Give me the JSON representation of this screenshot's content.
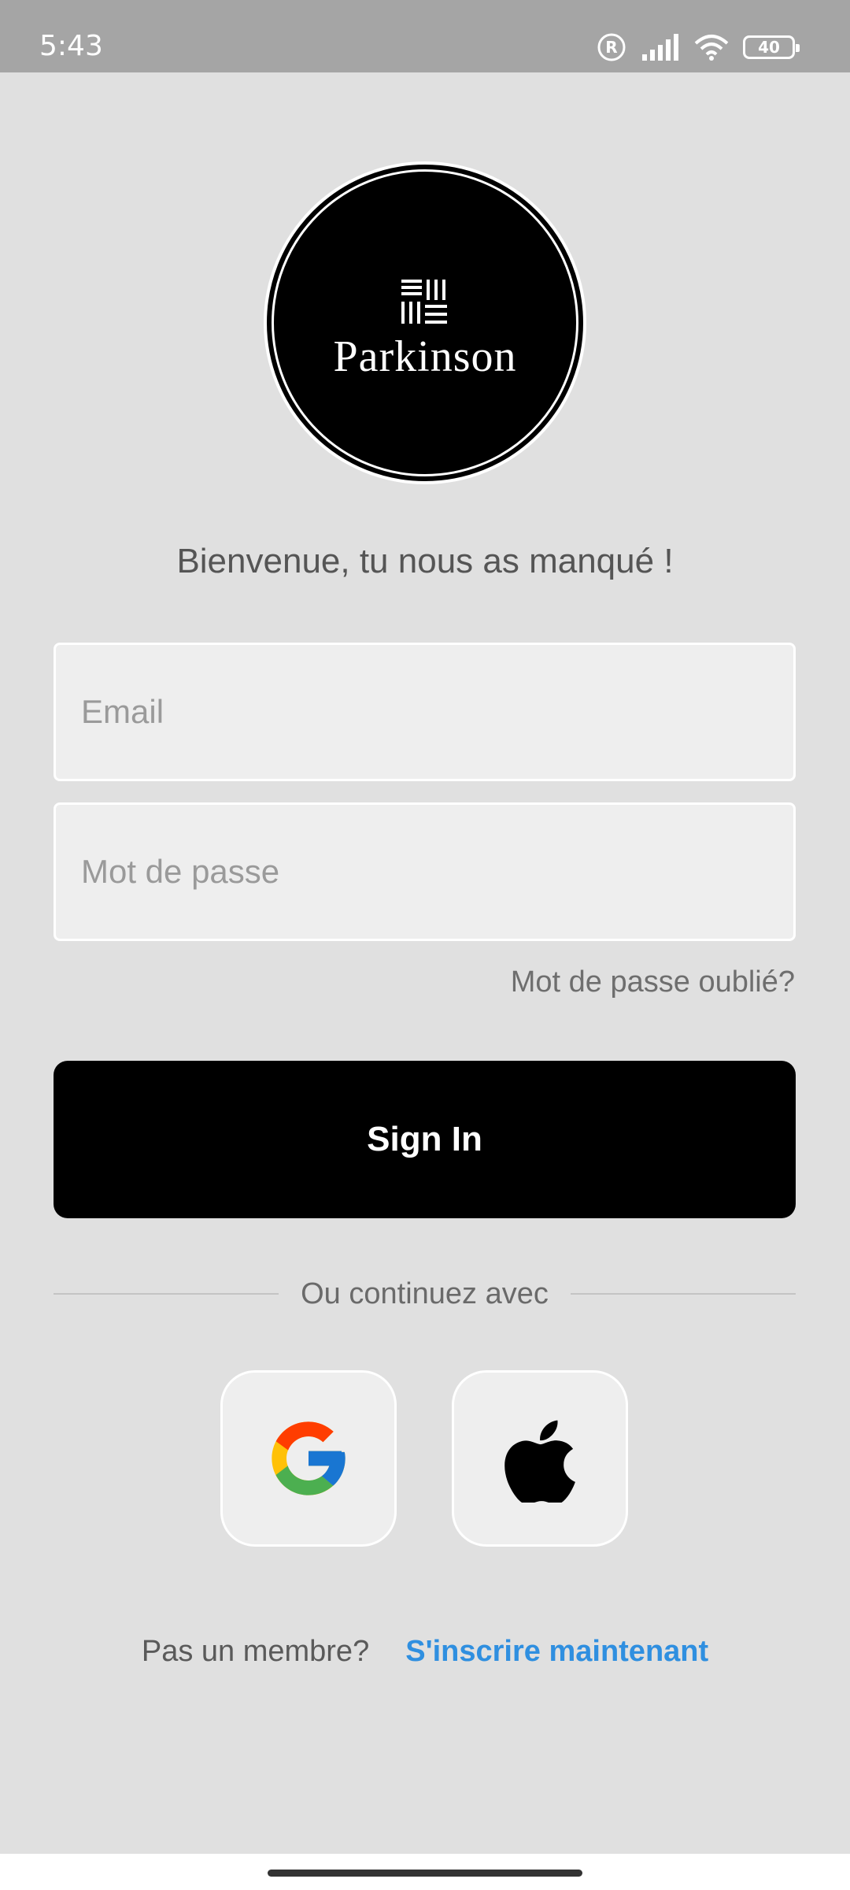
{
  "status_bar": {
    "time": "5:43",
    "battery_level": "40",
    "icons": [
      "registered-icon",
      "signal-icon",
      "wifi-icon",
      "battery-icon"
    ]
  },
  "logo": {
    "text": "Parkinson",
    "mark_icon": "parkinson-logo-mark-icon"
  },
  "welcome_text": "Bienvenue, tu nous as manqué !",
  "form": {
    "email_placeholder": "Email",
    "email_value": "",
    "password_placeholder": "Mot de passe",
    "password_value": "",
    "forgot_password_label": "Mot de passe oublié?",
    "sign_in_label": "Sign In"
  },
  "divider_text": "Ou continuez avec",
  "social": {
    "google_icon": "google-icon",
    "apple_icon": "apple-icon"
  },
  "signup": {
    "prompt": "Pas un membre?",
    "link_label": "S'inscrire maintenant"
  },
  "colors": {
    "background": "#e0e0e0",
    "status_bar": "#a5a5a5",
    "primary_button": "#000000",
    "link": "#2f8fe0"
  }
}
